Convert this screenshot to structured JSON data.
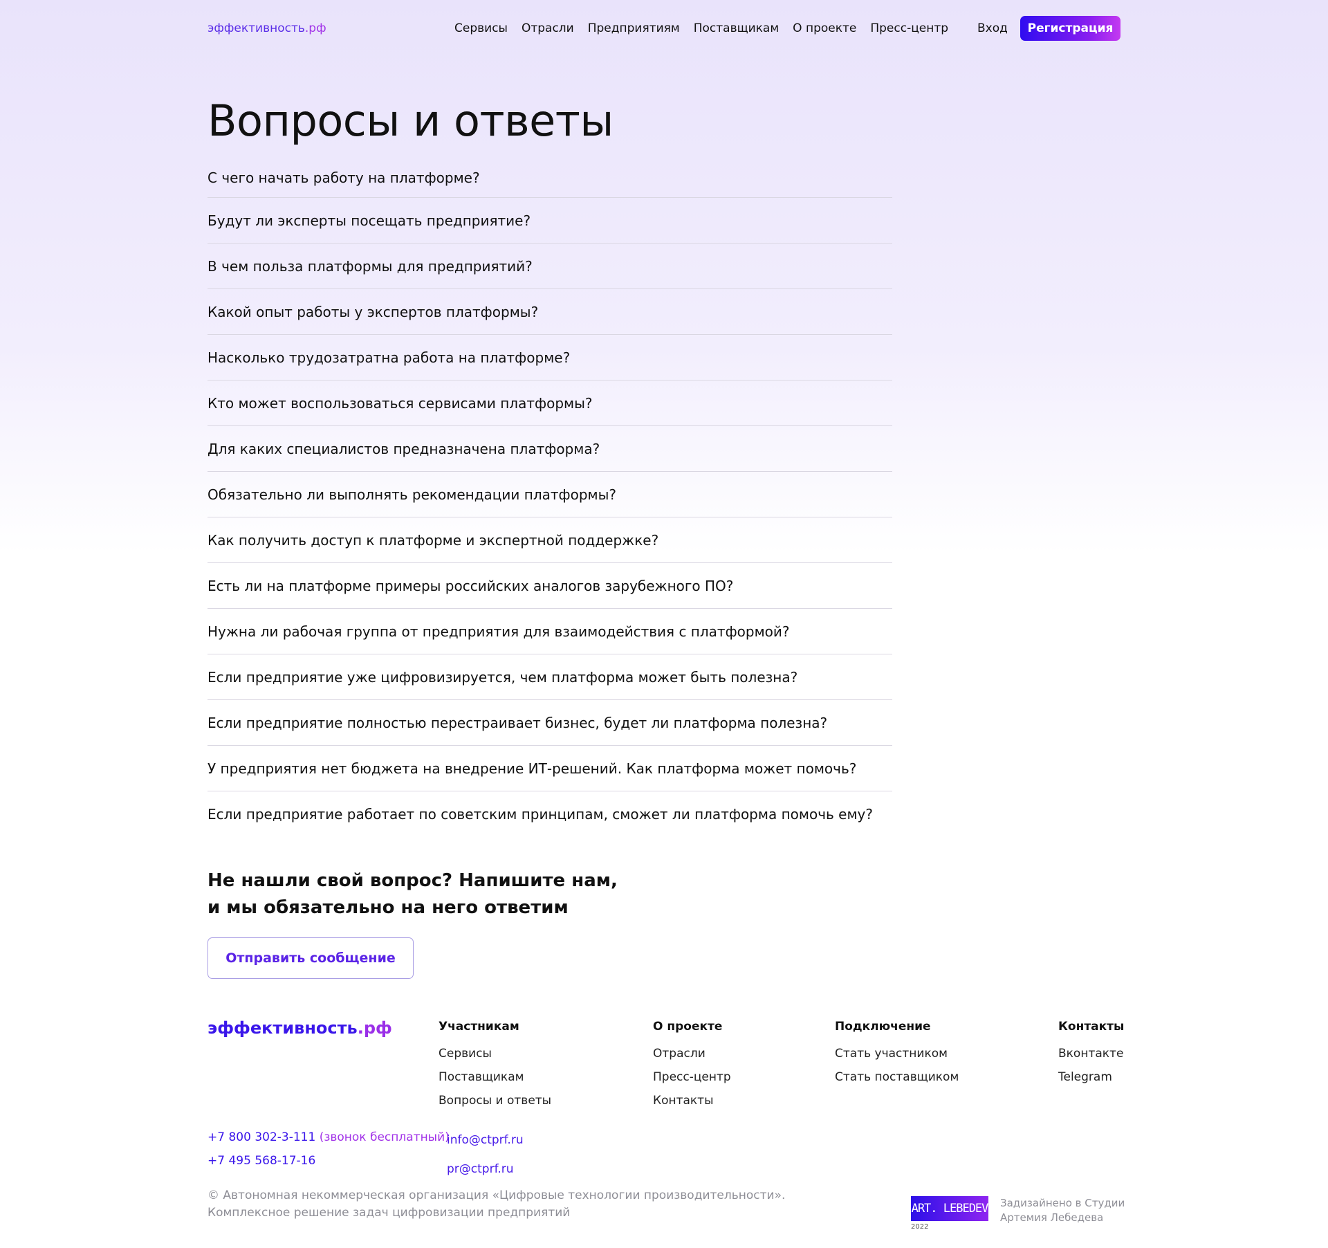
{
  "header": {
    "logo_main": "эффективность",
    "logo_tld": ".рф",
    "nav": [
      "Сервисы",
      "Отрасли",
      "Предприятиям",
      "Поставщикам",
      "О проекте",
      "Пресс-центр"
    ],
    "login": "Вход",
    "register": "Регистрация"
  },
  "page_title": "Вопросы и ответы",
  "faq": [
    "С чего начать работу на платформе?",
    "Будут ли эксперты посещать предприятие?",
    "В чем польза платформы для предприятий?",
    "Какой опыт работы у экспертов платформы?",
    "Насколько трудозатратна работа на платформе?",
    "Кто может воспользоваться сервисами платформы?",
    "Для каких специалистов предназначена платформа?",
    "Обязательно ли выполнять рекомендации платформы?",
    "Как получить доступ к платформе и экспертной поддержке?",
    "Есть ли на платформе примеры российских аналогов зарубежного ПО?",
    "Нужна ли рабочая группа от предприятия для взаимодействия с платформой?",
    "Если предприятие уже цифровизируется, чем платформа может быть полезна?",
    "Если предприятие полностью перестраивает бизнес, будет ли платформа полезна?",
    "У предприятия нет бюджета на внедрение ИТ-решений. Как платформа может помочь?",
    "Если предприятие работает по советским принципам, сможет ли платформа помочь ему?"
  ],
  "cta": {
    "line1": "Не нашли свой вопрос? Напишите нам,",
    "line2": "и мы обязательно на него ответим",
    "button": "Отправить сообщение"
  },
  "footer": {
    "logo_main": "эффективность",
    "logo_tld": ".рф",
    "columns": [
      {
        "title": "Участникам",
        "links": [
          "Сервисы",
          "Поставщикам",
          "Вопросы и ответы"
        ]
      },
      {
        "title": "О проекте",
        "links": [
          "Отрасли",
          "Пресс-центр",
          "Контакты"
        ]
      },
      {
        "title": "Подключение",
        "links": [
          "Стать участником",
          "Стать поставщиком"
        ]
      },
      {
        "title": "Контакты",
        "links": [
          "Вконтакте",
          "Telegram"
        ]
      }
    ],
    "phone1": "+7 800 302-3-111",
    "phone1_note": " (звонок бесплатный)",
    "phone2": "+7 495 568-17-16",
    "email1": "info@ctprf.ru",
    "email2": "pr@ctprf.ru",
    "copyright_line1": "© Автономная некоммерческая организация «Цифровые технологии производительности».",
    "copyright_line2": "Комплексное решение задач цифровизации предприятий",
    "studio_logo": "ART. LEBEDEV",
    "studio_year": "2022",
    "studio_line1": "Задизайнено в Студии",
    "studio_line2": "Артемия Лебедева"
  }
}
